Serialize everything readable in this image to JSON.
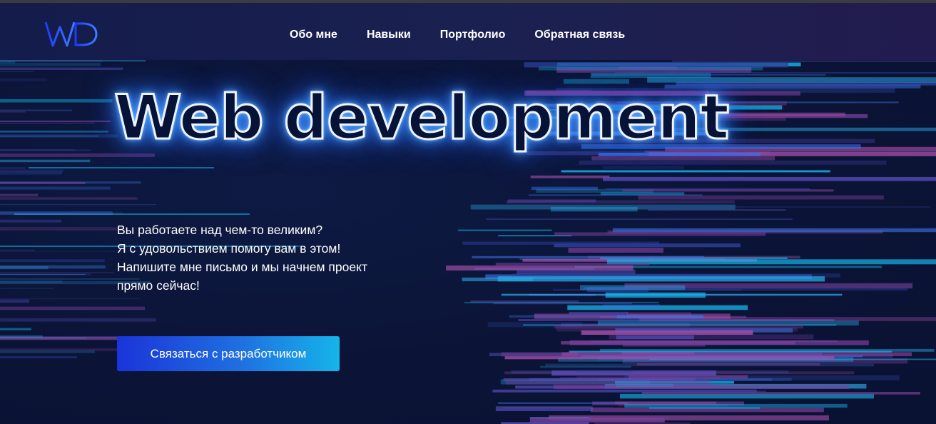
{
  "brand": {
    "logo_text": "WD"
  },
  "nav": {
    "items": [
      {
        "label": "Обо мне"
      },
      {
        "label": "Навыки"
      },
      {
        "label": "Портфолио"
      },
      {
        "label": "Обратная связь"
      }
    ]
  },
  "hero": {
    "title": "Web development",
    "tagline": [
      "Вы работаете над чем-то великим?",
      "Я с удовольствием помогу вам в этом!",
      "Напишите мне письмо и мы начнем проект",
      "прямо сейчас!"
    ],
    "cta_label": "Связаться с разработчиком"
  },
  "colors": {
    "background": "#0b1436",
    "accent_blue": "#1b34d9",
    "accent_cyan": "#16b4ea",
    "accent_purple": "#a24ea8"
  }
}
